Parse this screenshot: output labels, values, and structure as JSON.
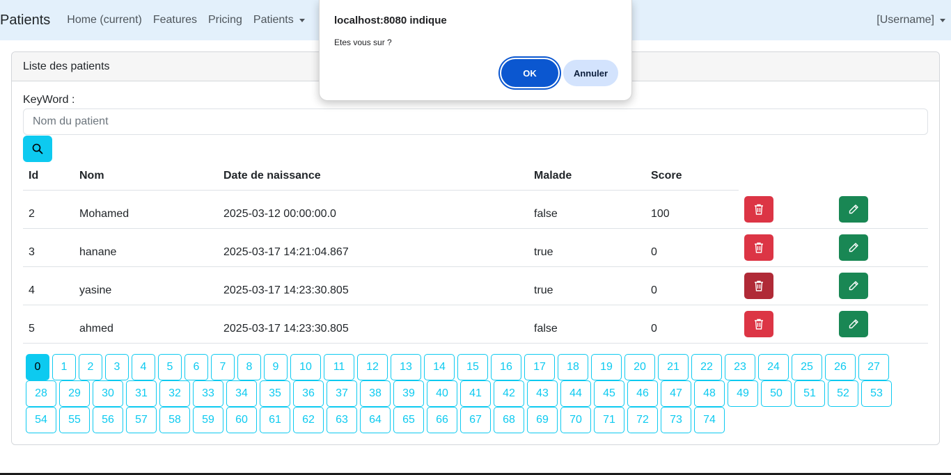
{
  "navbar": {
    "brand": "Patients",
    "links": [
      "Home (current)",
      "Features",
      "Pricing",
      "Patients"
    ],
    "user": "[Username]"
  },
  "card": {
    "header": "Liste des patients",
    "keyword_label": "KeyWord :",
    "search_placeholder": "Nom du patient"
  },
  "table": {
    "headers": [
      "Id",
      "Nom",
      "Date de naissance",
      "Malade",
      "Score"
    ],
    "rows": [
      {
        "id": "2",
        "nom": "Mohamed",
        "date": "2025-03-12 00:00:00.0",
        "malade": "false",
        "score": "100"
      },
      {
        "id": "3",
        "nom": "hanane",
        "date": "2025-03-17 14:21:04.867",
        "malade": "true",
        "score": "0"
      },
      {
        "id": "4",
        "nom": "yasine",
        "date": "2025-03-17 14:23:30.805",
        "malade": "true",
        "score": "0"
      },
      {
        "id": "5",
        "nom": "ahmed",
        "date": "2025-03-17 14:23:30.805",
        "malade": "false",
        "score": "0"
      }
    ]
  },
  "pagination": {
    "current": 0,
    "pages": [
      "0",
      "1",
      "2",
      "3",
      "4",
      "5",
      "6",
      "7",
      "8",
      "9",
      "10",
      "11",
      "12",
      "13",
      "14",
      "15",
      "16",
      "17",
      "18",
      "19",
      "20",
      "21",
      "22",
      "23",
      "24",
      "25",
      "26",
      "27",
      "28",
      "29",
      "30",
      "31",
      "32",
      "33",
      "34",
      "35",
      "36",
      "37",
      "38",
      "39",
      "40",
      "41",
      "42",
      "43",
      "44",
      "45",
      "46",
      "47",
      "48",
      "49",
      "50",
      "51",
      "52",
      "53",
      "54",
      "55",
      "56",
      "57",
      "58",
      "59",
      "60",
      "61",
      "62",
      "63",
      "64",
      "65",
      "66",
      "67",
      "68",
      "69",
      "70",
      "71",
      "72",
      "73",
      "74"
    ]
  },
  "dialog": {
    "title": "localhost:8080 indique",
    "message": "Etes vous sur ?",
    "ok_label": "OK",
    "cancel_label": "Annuler"
  },
  "colors": {
    "navbar_bg": "#e3f0fb",
    "info": "#0dcaf0",
    "danger": "#dc3545",
    "success": "#198754",
    "dialog_primary": "#0b57d0"
  },
  "icons": {
    "search": "search-icon",
    "delete": "trash-icon",
    "edit": "pencil-icon",
    "dropdown": "caret-down-icon"
  }
}
